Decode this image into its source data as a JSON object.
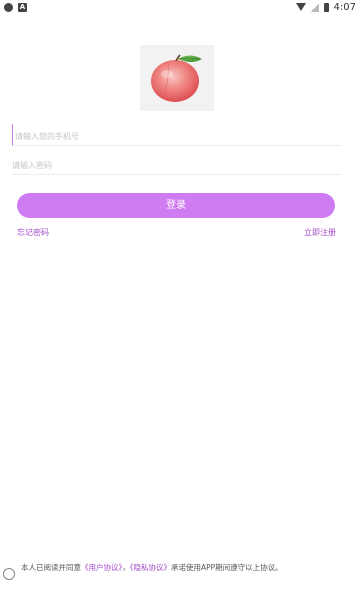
{
  "status_bar": {
    "time": "4:07",
    "left_icons": [
      "chat-bubble-icon",
      "a-icon"
    ],
    "right_icons": [
      "wifi-icon",
      "signal-icon",
      "battery-icon"
    ]
  },
  "logo": {
    "icon": "peach-icon"
  },
  "form": {
    "phone_placeholder": "请输入您的手机号",
    "password_placeholder": "请输入密码",
    "login_label": "登录"
  },
  "links": {
    "forgot_password": "忘记密码",
    "register": "立即注册"
  },
  "agreement": {
    "prefix": "本人已阅读并同意",
    "user_agreement": "《用户协议》",
    "separator": "，",
    "privacy_policy": "《隐私协议》",
    "suffix": "承诺使用APP期间遵守以上协议。"
  },
  "colors": {
    "accent": "#cf7cf2",
    "link": "#a349c9"
  }
}
